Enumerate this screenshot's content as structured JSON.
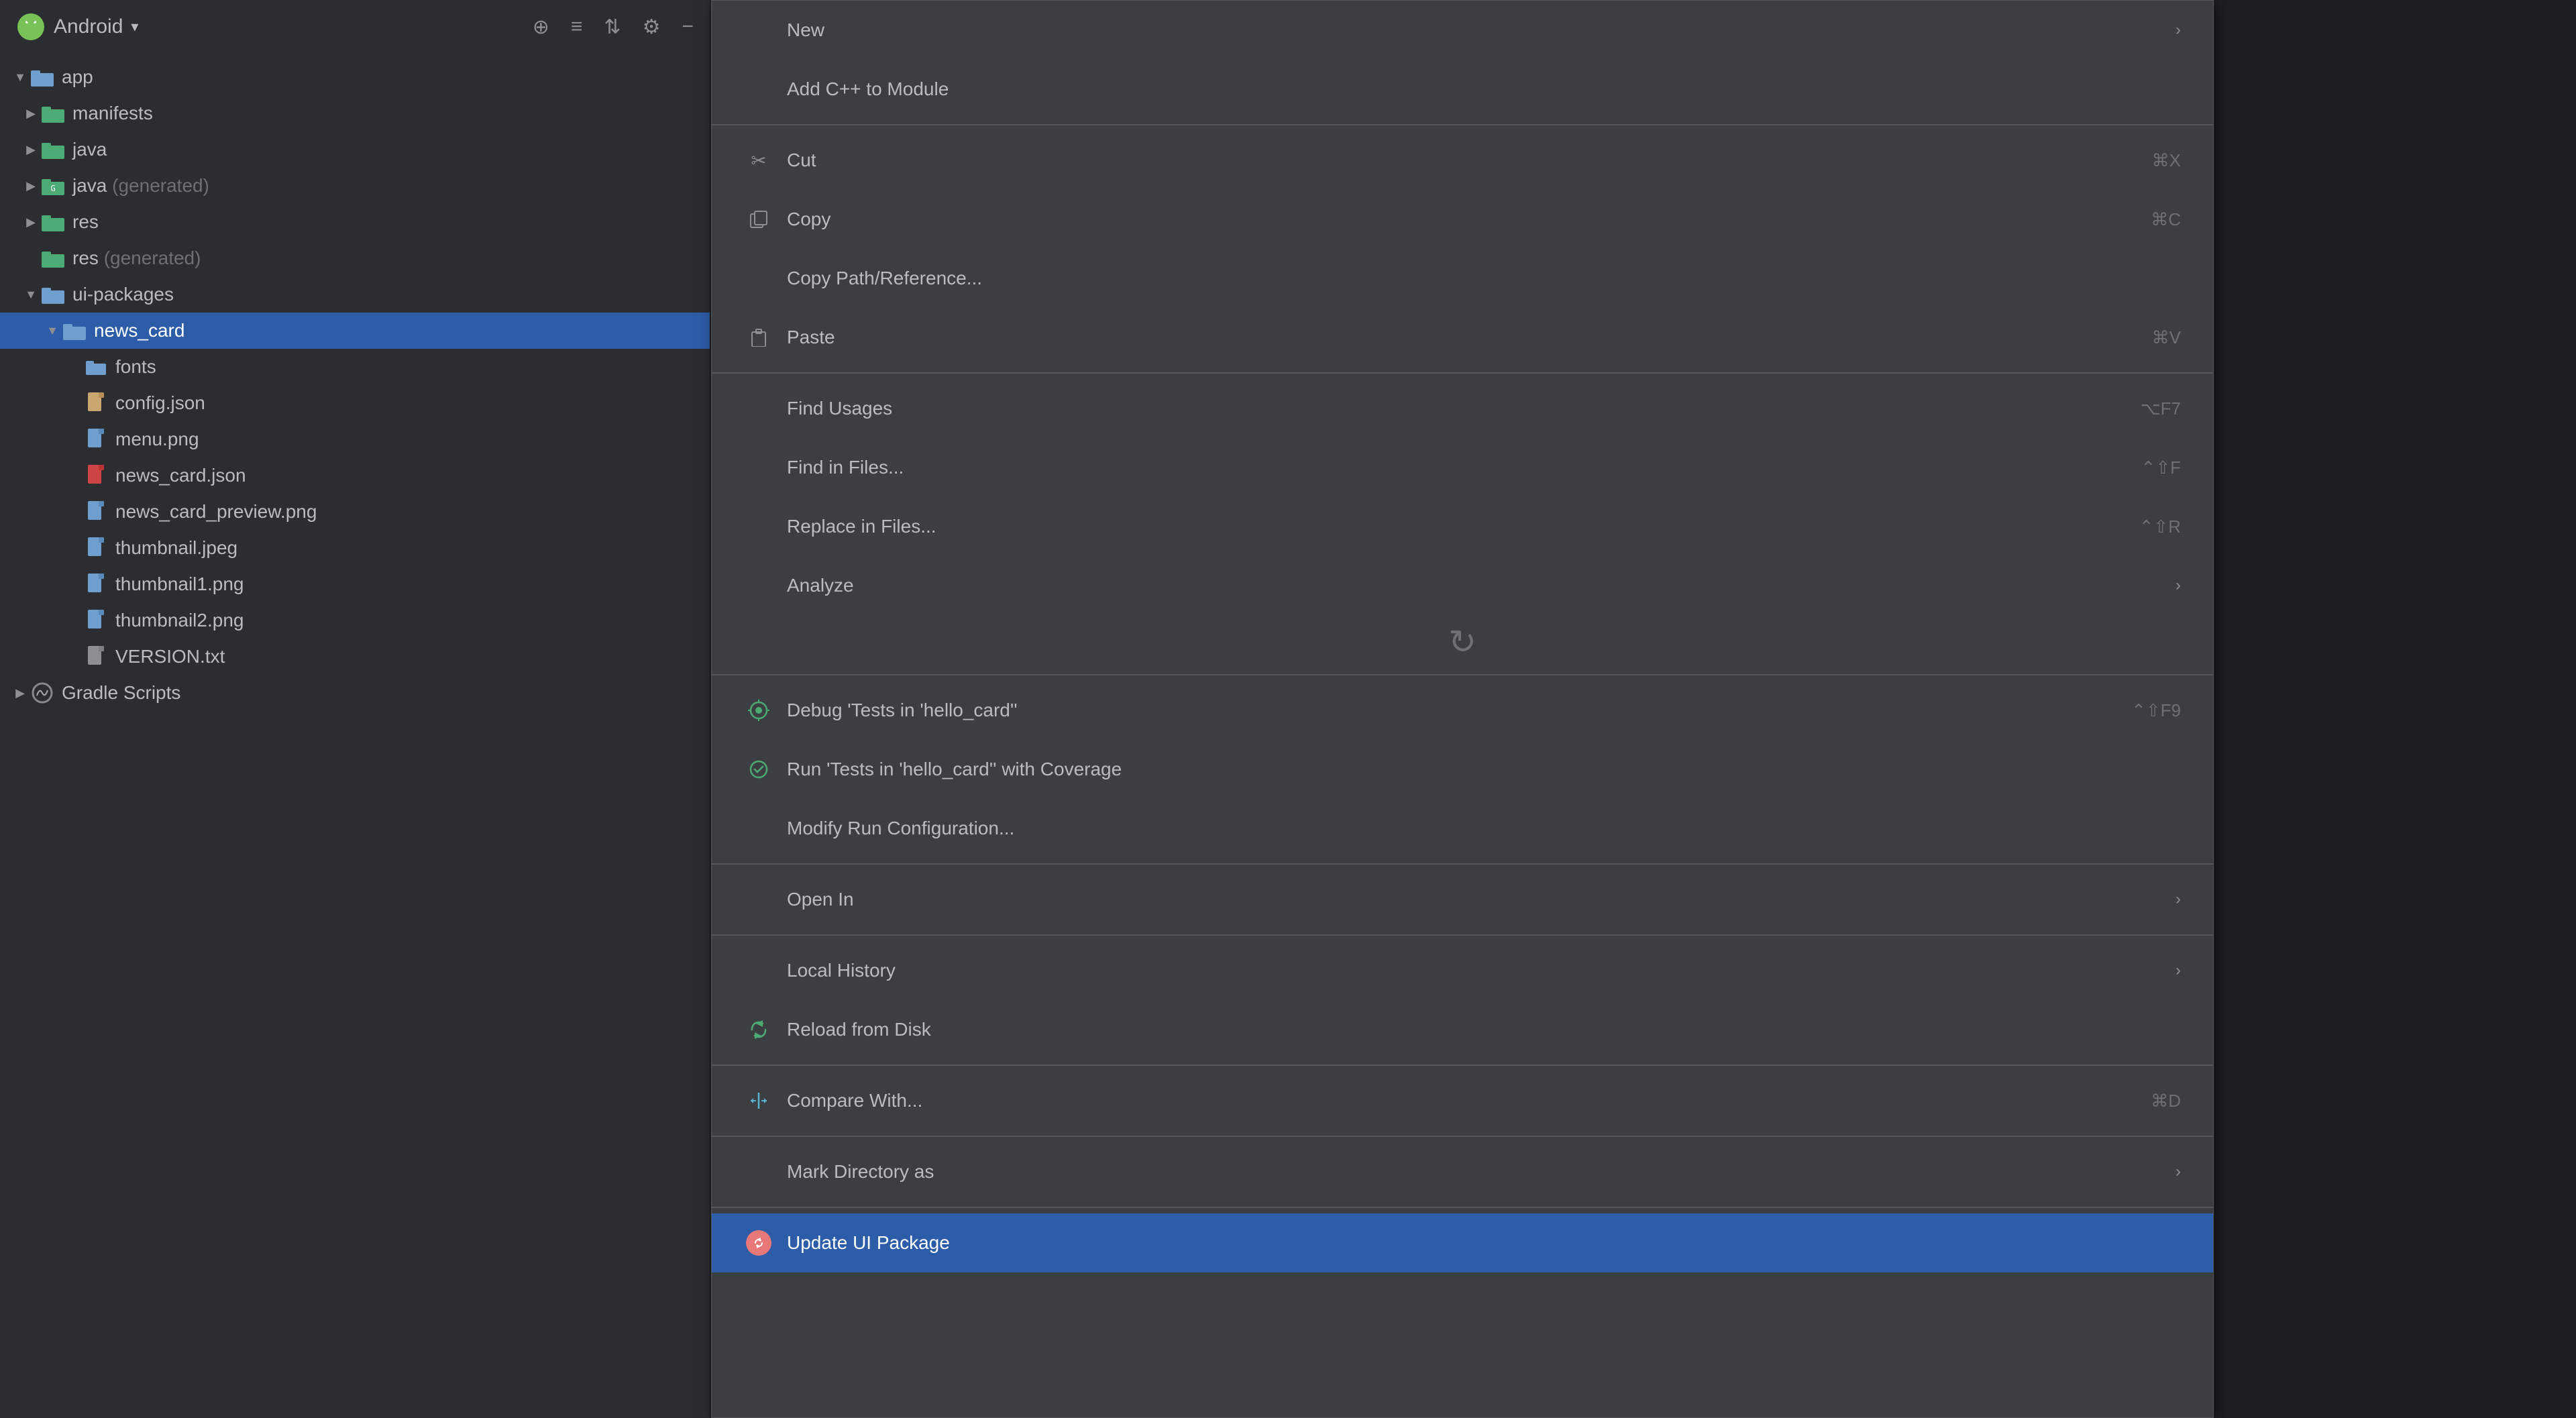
{
  "sidebar": {
    "title": "Android",
    "header_icons": [
      "target-icon",
      "collapse-all-icon",
      "expand-icon",
      "settings-icon",
      "minimize-icon"
    ],
    "tree": [
      {
        "id": "app",
        "label": "app",
        "indent": 0,
        "type": "folder-module",
        "expanded": true,
        "chevron": "▼"
      },
      {
        "id": "manifests",
        "label": "manifests",
        "indent": 1,
        "type": "folder",
        "expanded": false,
        "chevron": "▶"
      },
      {
        "id": "java",
        "label": "java",
        "indent": 1,
        "type": "folder",
        "expanded": false,
        "chevron": "▶"
      },
      {
        "id": "java-gen",
        "label": "java",
        "suffix": " (generated)",
        "indent": 1,
        "type": "folder-gen",
        "expanded": false,
        "chevron": "▶"
      },
      {
        "id": "res",
        "label": "res",
        "indent": 1,
        "type": "folder",
        "expanded": false,
        "chevron": "▶"
      },
      {
        "id": "res-gen",
        "label": "res",
        "suffix": " (generated)",
        "indent": 1,
        "type": "folder",
        "expanded": false,
        "chevron": ""
      },
      {
        "id": "ui-packages",
        "label": "ui-packages",
        "indent": 1,
        "type": "folder",
        "expanded": true,
        "chevron": "▼"
      },
      {
        "id": "news_card",
        "label": "news_card",
        "indent": 2,
        "type": "folder",
        "expanded": true,
        "chevron": "▼",
        "selected": true
      },
      {
        "id": "fonts",
        "label": "fonts",
        "indent": 3,
        "type": "folder",
        "expanded": false,
        "chevron": ""
      },
      {
        "id": "config.json",
        "label": "config.json",
        "indent": 3,
        "type": "file-json"
      },
      {
        "id": "menu.png",
        "label": "menu.png",
        "indent": 3,
        "type": "file-png"
      },
      {
        "id": "news_card.json",
        "label": "news_card.json",
        "indent": 3,
        "type": "file-red"
      },
      {
        "id": "news_card_preview.png",
        "label": "news_card_preview.png",
        "indent": 3,
        "type": "file-png"
      },
      {
        "id": "thumbnail.jpeg",
        "label": "thumbnail.jpeg",
        "indent": 3,
        "type": "file-png"
      },
      {
        "id": "thumbnail1.png",
        "label": "thumbnail1.png",
        "indent": 3,
        "type": "file-png"
      },
      {
        "id": "thumbnail2.png",
        "label": "thumbnail2.png",
        "indent": 3,
        "type": "file-png"
      },
      {
        "id": "VERSION.txt",
        "label": "VERSION.txt",
        "indent": 3,
        "type": "file-txt"
      },
      {
        "id": "gradle-scripts",
        "label": "Gradle Scripts",
        "indent": 0,
        "type": "folder-gradle",
        "expanded": false,
        "chevron": "▶"
      }
    ]
  },
  "context_menu": {
    "items": [
      {
        "id": "new",
        "label": "New",
        "icon": "none",
        "shortcut": "",
        "has_arrow": true,
        "separator_above": false
      },
      {
        "id": "add-cpp",
        "label": "Add C++ to Module",
        "icon": "none",
        "shortcut": "",
        "has_arrow": false,
        "separator_above": false
      },
      {
        "id": "cut",
        "label": "Cut",
        "icon": "cut",
        "shortcut": "⌘X",
        "has_arrow": false,
        "separator_above": true
      },
      {
        "id": "copy",
        "label": "Copy",
        "icon": "copy",
        "shortcut": "⌘C",
        "has_arrow": false,
        "separator_above": false
      },
      {
        "id": "copy-path",
        "label": "Copy Path/Reference...",
        "icon": "none",
        "shortcut": "",
        "has_arrow": false,
        "separator_above": false
      },
      {
        "id": "paste",
        "label": "Paste",
        "icon": "paste",
        "shortcut": "⌘V",
        "has_arrow": false,
        "separator_above": false
      },
      {
        "id": "find-usages",
        "label": "Find Usages",
        "icon": "none",
        "shortcut": "⌥F7",
        "has_arrow": false,
        "separator_above": true
      },
      {
        "id": "find-in-files",
        "label": "Find in Files...",
        "icon": "none",
        "shortcut": "⌃⇧F",
        "has_arrow": false,
        "separator_above": false
      },
      {
        "id": "replace-in-files",
        "label": "Replace in Files...",
        "icon": "none",
        "shortcut": "⌃⇧R",
        "has_arrow": false,
        "separator_above": false
      },
      {
        "id": "analyze",
        "label": "Analyze",
        "icon": "none",
        "shortcut": "",
        "has_arrow": true,
        "separator_above": false
      },
      {
        "id": "spinner",
        "label": "",
        "icon": "spinner",
        "shortcut": "",
        "has_arrow": false,
        "separator_above": false,
        "type": "spinner"
      },
      {
        "id": "debug",
        "label": "Debug 'Tests in 'hello_card''",
        "icon": "debug",
        "shortcut": "⌃⇧F9",
        "has_arrow": false,
        "separator_above": true
      },
      {
        "id": "run-coverage",
        "label": "Run 'Tests in 'hello_card'' with Coverage",
        "icon": "coverage",
        "shortcut": "",
        "has_arrow": false,
        "separator_above": false
      },
      {
        "id": "modify-run",
        "label": "Modify Run Configuration...",
        "icon": "none",
        "shortcut": "",
        "has_arrow": false,
        "separator_above": false
      },
      {
        "id": "open-in",
        "label": "Open In",
        "icon": "none",
        "shortcut": "",
        "has_arrow": true,
        "separator_above": true
      },
      {
        "id": "local-history",
        "label": "Local History",
        "icon": "none",
        "shortcut": "",
        "has_arrow": true,
        "separator_above": true
      },
      {
        "id": "reload-disk",
        "label": "Reload from Disk",
        "icon": "reload",
        "shortcut": "",
        "has_arrow": false,
        "separator_above": false
      },
      {
        "id": "compare-with",
        "label": "Compare With...",
        "icon": "compare",
        "shortcut": "⌘D",
        "has_arrow": false,
        "separator_above": true
      },
      {
        "id": "mark-dir",
        "label": "Mark Directory as",
        "icon": "none",
        "shortcut": "",
        "has_arrow": true,
        "separator_above": true
      },
      {
        "id": "update-ui",
        "label": "Update UI Package",
        "icon": "update",
        "shortcut": "",
        "has_arrow": false,
        "separator_above": true,
        "highlighted": true
      }
    ]
  }
}
